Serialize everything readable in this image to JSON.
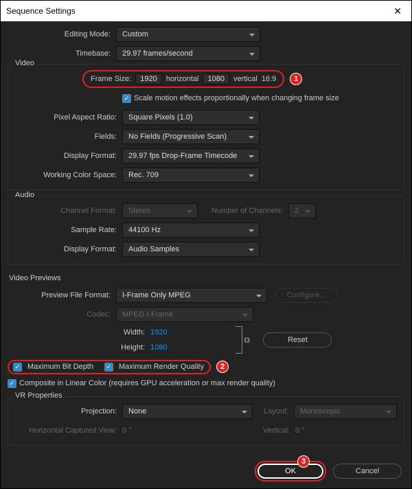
{
  "window": {
    "title": "Sequence Settings"
  },
  "top": {
    "editing_mode_label": "Editing Mode:",
    "editing_mode_value": "Custom",
    "timebase_label": "Timebase:",
    "timebase_value": "29.97  frames/second"
  },
  "video": {
    "title": "Video",
    "frame_size_label": "Frame Size:",
    "width": "1920",
    "horizontal": "horizontal",
    "height": "1080",
    "vertical": "vertical",
    "aspect": "16:9",
    "scale_label": "Scale motion effects proportionally when changing frame size",
    "par_label": "Pixel Aspect Ratio:",
    "par_value": "Square Pixels (1.0)",
    "fields_label": "Fields:",
    "fields_value": "No Fields (Progressive Scan)",
    "disp_label": "Display Format:",
    "disp_value": "29.97 fps Drop-Frame Timecode",
    "wcs_label": "Working Color Space:",
    "wcs_value": "Rec. 709"
  },
  "audio": {
    "title": "Audio",
    "chfmt_label": "Channel Format:",
    "chfmt_value": "Stereo",
    "numch_label": "Number of Channels:",
    "numch_value": "2",
    "rate_label": "Sample Rate:",
    "rate_value": "44100 Hz",
    "disp_label": "Display Format:",
    "disp_value": "Audio Samples"
  },
  "previews": {
    "title": "Video Previews",
    "pff_label": "Preview File Format:",
    "pff_value": "I-Frame Only MPEG",
    "configure": "Configure...",
    "codec_label": "Codec:",
    "codec_value": "MPEG I-Frame",
    "width_label": "Width:",
    "width_value": "1920",
    "height_label": "Height:",
    "height_value": "1080",
    "reset": "Reset",
    "max_bit": "Maximum Bit Depth",
    "max_rq": "Maximum Render Quality",
    "composite": "Composite in Linear Color (requires GPU acceleration or max render quality)"
  },
  "vr": {
    "title": "VR Properties",
    "proj_label": "Projection:",
    "proj_value": "None",
    "layout_label": "Layout:",
    "layout_value": "Monoscopic",
    "hcv_label": "Horizontal Captured View:",
    "hcv_value": "0 °",
    "vert_label": "Vertical:",
    "vert_value": "0 °"
  },
  "badges": {
    "b1": "1",
    "b2": "2",
    "b3": "3"
  },
  "footer": {
    "ok": "OK",
    "cancel": "Cancel"
  }
}
